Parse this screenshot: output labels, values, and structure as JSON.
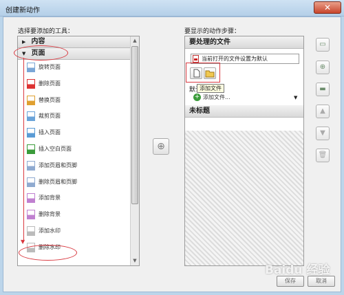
{
  "window": {
    "title": "创建新动作",
    "close_glyph": "✕"
  },
  "left": {
    "heading": "选择要添加的工具：",
    "categories": [
      {
        "label": "内容",
        "arrow": "▶"
      },
      {
        "label": "页面",
        "arrow": "▼"
      }
    ],
    "tools": [
      {
        "label": "旋转页面",
        "icon": "rotate-page-icon",
        "color": "#7aa6d6"
      },
      {
        "label": "删除页面",
        "icon": "delete-page-icon",
        "color": "#d33"
      },
      {
        "label": "替换页面",
        "icon": "replace-page-icon",
        "color": "#e0a030"
      },
      {
        "label": "裁剪页面",
        "icon": "crop-page-icon",
        "color": "#6aa3d9"
      },
      {
        "label": "插入页面",
        "icon": "insert-page-icon",
        "color": "#5a9bd5"
      },
      {
        "label": "插入空白页面",
        "icon": "insert-blank-page-icon",
        "color": "#3a9b3a"
      },
      {
        "label": "添加页眉和页脚",
        "icon": "add-header-footer-icon",
        "color": "#8faad0"
      },
      {
        "label": "删除页眉和页脚",
        "icon": "remove-header-footer-icon",
        "color": "#8faad0"
      },
      {
        "label": "添加背景",
        "icon": "add-background-icon",
        "color": "#c080d0"
      },
      {
        "label": "删除背景",
        "icon": "remove-background-icon",
        "color": "#c080d0"
      },
      {
        "label": "添加水印",
        "icon": "add-watermark-icon",
        "color": "#bbbbbb"
      },
      {
        "label": "删除水印",
        "icon": "remove-watermark-icon",
        "color": "#bbbbbb"
      }
    ]
  },
  "right": {
    "heading": "要显示的动作步骤：",
    "section1": "要处理的文件",
    "file_option": "当前打开的文件设置为默认",
    "tooltip": "添加文件",
    "default_label": "默认",
    "add_files": "添加文件...",
    "section2": "未标题"
  },
  "dialog": {
    "save": "保存",
    "cancel": "取消"
  },
  "watermark": "Baidu 经验"
}
